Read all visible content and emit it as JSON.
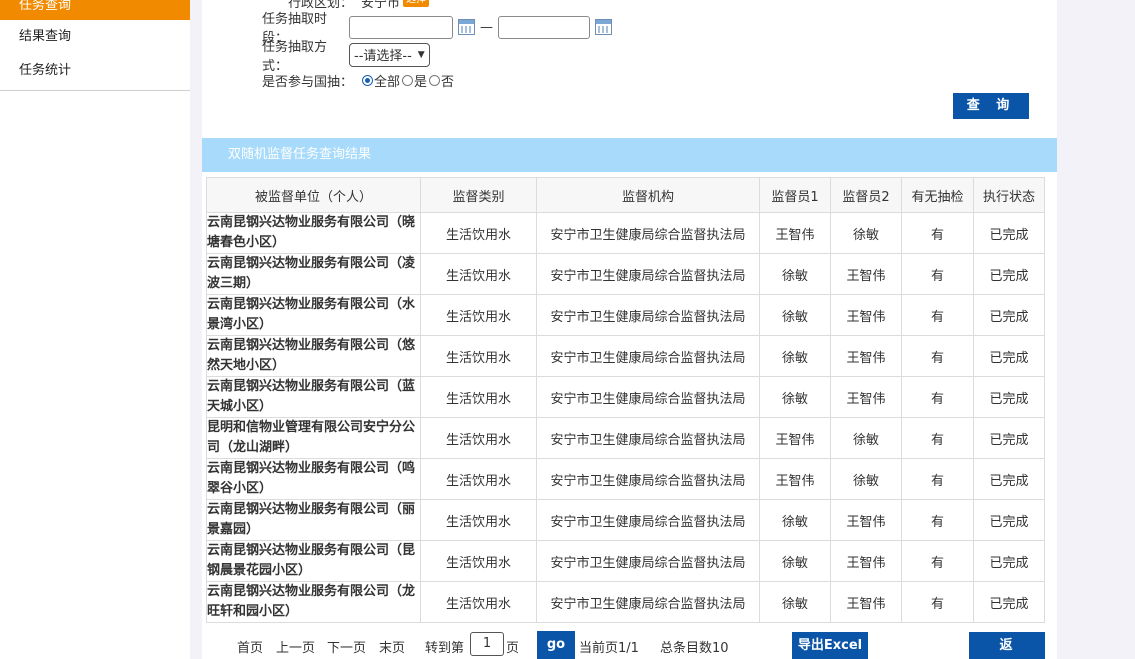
{
  "sidebar": {
    "items": [
      {
        "label": "任务查询",
        "active": true
      },
      {
        "label": "结果查询",
        "active": false
      },
      {
        "label": "任务统计",
        "active": false
      }
    ]
  },
  "form": {
    "region_label": "行政区划：",
    "region_value": "安宁市",
    "region_button": "选择",
    "period_label": "任务抽取时段：",
    "period_separator": "—",
    "method_label": "任务抽取方式：",
    "method_selected": "--请选择--",
    "national_label": "是否参与国抽：",
    "national_options": [
      "全部",
      "是",
      "否"
    ],
    "national_selected": "全部",
    "query_button": "查 询"
  },
  "results": {
    "title": "双随机监督任务查询结果",
    "columns": [
      "被监督单位（个人）",
      "监督类别",
      "监督机构",
      "监督员1",
      "监督员2",
      "有无抽检",
      "执行状态"
    ],
    "rows": [
      [
        "云南昆钢兴达物业服务有限公司（晓塘春色小区）",
        "生活饮用水",
        "安宁市卫生健康局综合监督执法局",
        "王智伟",
        "徐敏",
        "有",
        "已完成"
      ],
      [
        "云南昆钢兴达物业服务有限公司（凌波三期）",
        "生活饮用水",
        "安宁市卫生健康局综合监督执法局",
        "徐敏",
        "王智伟",
        "有",
        "已完成"
      ],
      [
        "云南昆钢兴达物业服务有限公司（水景湾小区）",
        "生活饮用水",
        "安宁市卫生健康局综合监督执法局",
        "徐敏",
        "王智伟",
        "有",
        "已完成"
      ],
      [
        "云南昆钢兴达物业服务有限公司（悠然天地小区）",
        "生活饮用水",
        "安宁市卫生健康局综合监督执法局",
        "徐敏",
        "王智伟",
        "有",
        "已完成"
      ],
      [
        "云南昆钢兴达物业服务有限公司（蓝天城小区）",
        "生活饮用水",
        "安宁市卫生健康局综合监督执法局",
        "徐敏",
        "王智伟",
        "有",
        "已完成"
      ],
      [
        "昆明和信物业管理有限公司安宁分公司（龙山湖畔）",
        "生活饮用水",
        "安宁市卫生健康局综合监督执法局",
        "王智伟",
        "徐敏",
        "有",
        "已完成"
      ],
      [
        "云南昆钢兴达物业服务有限公司（鸣翠谷小区）",
        "生活饮用水",
        "安宁市卫生健康局综合监督执法局",
        "王智伟",
        "徐敏",
        "有",
        "已完成"
      ],
      [
        "云南昆钢兴达物业服务有限公司（丽景嘉园）",
        "生活饮用水",
        "安宁市卫生健康局综合监督执法局",
        "徐敏",
        "王智伟",
        "有",
        "已完成"
      ],
      [
        "云南昆钢兴达物业服务有限公司（昆钢晨景花园小区）",
        "生活饮用水",
        "安宁市卫生健康局综合监督执法局",
        "徐敏",
        "王智伟",
        "有",
        "已完成"
      ],
      [
        "云南昆钢兴达物业服务有限公司（龙旺轩和园小区）",
        "生活饮用水",
        "安宁市卫生健康局综合监督执法局",
        "徐敏",
        "王智伟",
        "有",
        "已完成"
      ]
    ]
  },
  "pager": {
    "first": "首页",
    "prev": "上一页",
    "next": "下一页",
    "last": "末页",
    "goto_prefix": "转到第",
    "goto_value": "1",
    "goto_suffix": "页",
    "go": "go",
    "current": "当前页1/1",
    "total": "总条目数10",
    "export": "导出Excel",
    "back": "返 回"
  },
  "colors": {
    "accent_orange": "#f28a00",
    "button_blue": "#0a55a8",
    "header_light_blue": "#a8dbfb"
  }
}
